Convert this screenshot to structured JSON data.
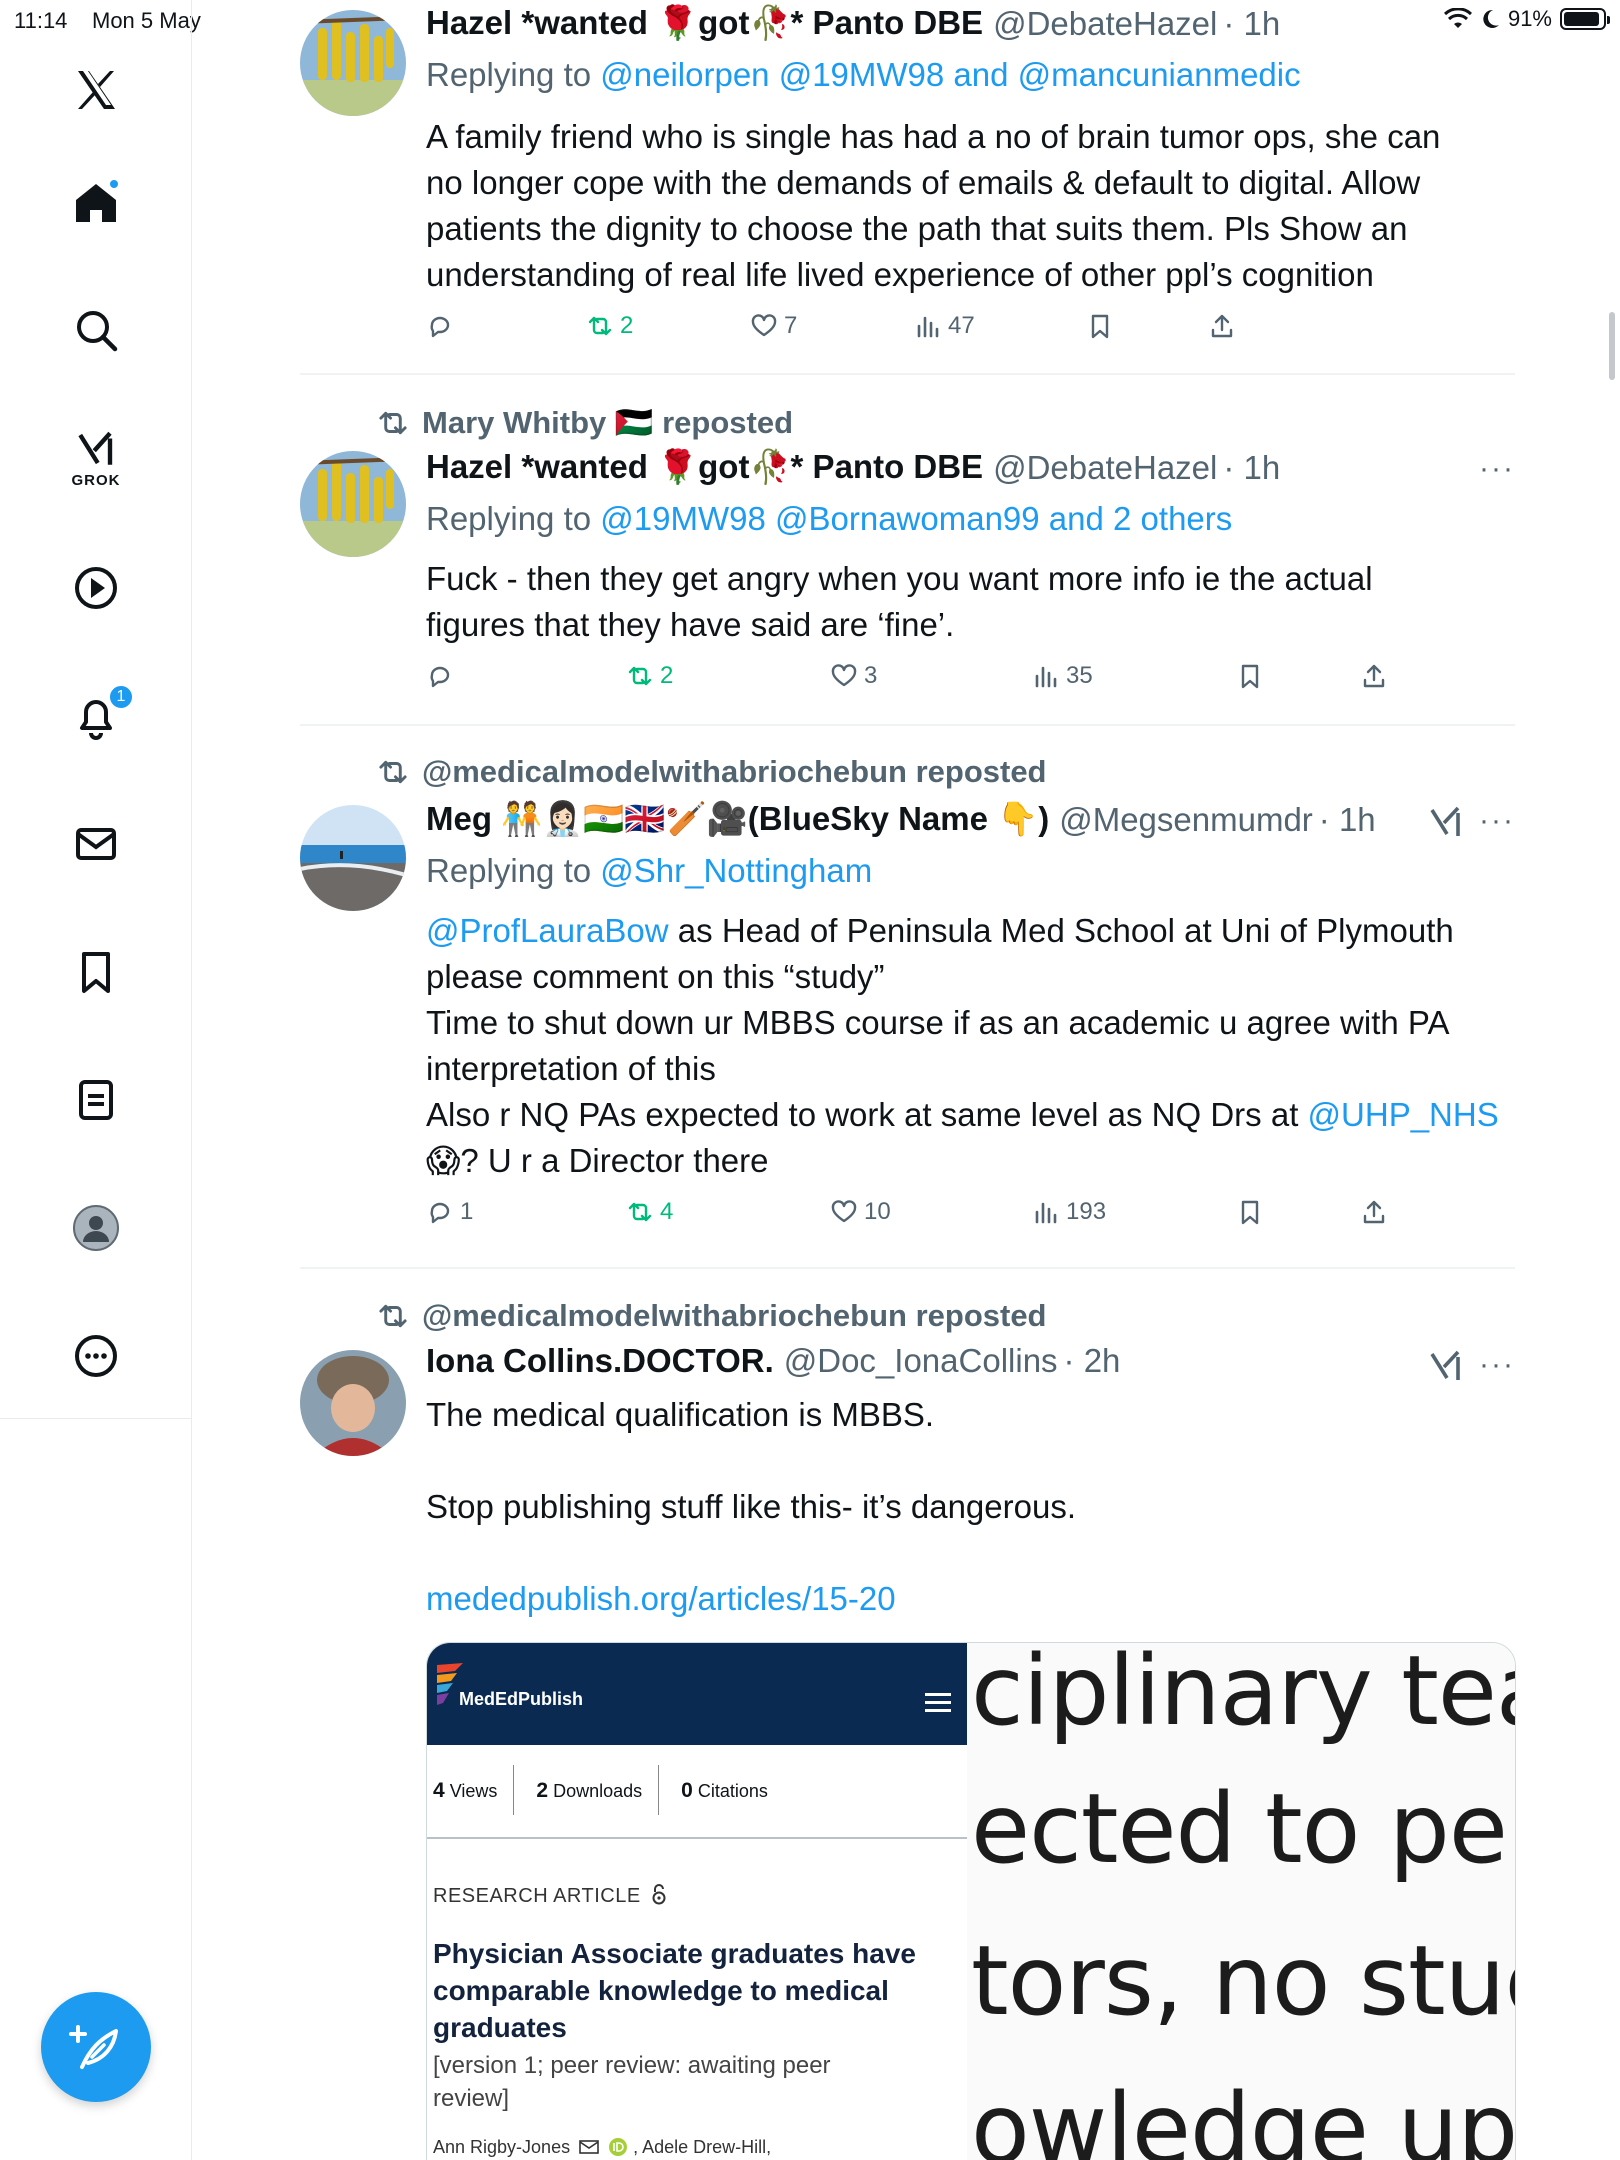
{
  "status_bar": {
    "time": "11:14",
    "date": "Mon 5 May",
    "battery": "91%",
    "battery_level": 0.91
  },
  "sidebar": {
    "items": [
      {
        "name": "X",
        "icon": "x-logo-icon"
      },
      {
        "name": "Home",
        "icon": "home-icon"
      },
      {
        "name": "Explore",
        "icon": "search-icon"
      },
      {
        "name": "Grok",
        "icon": "grok-icon",
        "label": "GROK"
      },
      {
        "name": "Video",
        "icon": "play-icon"
      },
      {
        "name": "Notifications",
        "icon": "bell-icon",
        "badge": "1"
      },
      {
        "name": "Messages",
        "icon": "mail-icon"
      },
      {
        "name": "Bookmarks",
        "icon": "bookmark-icon"
      },
      {
        "name": "Lists",
        "icon": "list-icon"
      },
      {
        "name": "Profile",
        "icon": "profile-icon"
      },
      {
        "name": "More",
        "icon": "more-circle-icon"
      }
    ],
    "compose_icon": "compose-icon"
  },
  "posts": [
    {
      "name": "Hazel *wanted 🌹got🥀* Panto DBE",
      "handle": "@DebateHazel",
      "time": "· 1h",
      "replying_to_prefix": "Replying to ",
      "replying_to": "@neilorpen @19MW98 and @mancunianmedic",
      "text": [
        "A family friend who is single has had a no of brain tumor ops,  she can",
        "no longer cope with the demands of emails & default to digital. Allow",
        "patients the dignity to choose the path that suits them. Pls Show an",
        "understanding of real life lived experience of other ppl’s cognition"
      ],
      "replies": "",
      "reposts": "2",
      "likes": "7",
      "views": "47"
    },
    {
      "reposted_by": "Mary Whitby 🇵🇸 reposted",
      "name": "Hazel *wanted 🌹got🥀* Panto DBE",
      "handle": "@DebateHazel",
      "time": "· 1h",
      "more": "···",
      "replying_to_prefix": "Replying to ",
      "replying_to": "@19MW98 @Bornawoman99 and 2 others",
      "text": [
        "Fuck - then they get angry when you want more info ie the actual",
        "figures that they have said are ‘fine’."
      ],
      "replies": "",
      "reposts": "2",
      "likes": "3",
      "views": "35"
    },
    {
      "reposted_by": "@medicalmodelwithabriochebun reposted",
      "name": "Meg 🧑‍🤝‍🧑👩🏻‍⚕️🇮🇳🇬🇧🏏🎥(BlueSky Name 👇)",
      "handle": "@Megsenmumdr",
      "time": "· 1h",
      "more": "···",
      "replying_to_prefix": "Replying to ",
      "replying_to": "@Shr_Nottingham",
      "text_mention_1": "@ProfLauraBow",
      "text_line_1_rest": " as Head of Peninsula Med School at Uni of Plymouth",
      "text_line_2": "please comment on this “study”",
      "text_line_3": "Time to shut down ur MBBS course if as an academic u agree with PA",
      "text_line_4": "interpretation of this",
      "text_line_5_start": "Also r NQ PAs expected to work at same level as NQ Drs at ",
      "text_mention_2": "@UHP_NHS",
      "text_line_6": "😱? U r a Director there",
      "replies": "1",
      "reposts": "4",
      "likes": "10",
      "views": "193"
    },
    {
      "reposted_by": "@medicalmodelwithabriochebun reposted",
      "name": "Iona Collins.DOCTOR.",
      "handle": "@Doc_IonaCollins",
      "time": "· 2h",
      "more": "···",
      "text_line_1": "The medical qualification is MBBS.",
      "text_line_2": "Stop publishing stuff like this- it’s dangerous.",
      "link": "mededpublish.org/articles/15-20",
      "card": {
        "brand": "MedEdPublish",
        "views_count": "4",
        "views_label": "Views",
        "downloads_count": "2",
        "downloads_label": "Downloads",
        "citations_count": "0",
        "citations_label": "Citations",
        "article_type": "RESEARCH ARTICLE",
        "title": "Physician Associate graduates have comparable knowledge to medical graduates",
        "version": "[version 1; peer review: awaiting peer review]",
        "authors": "Ann Rigby-Jones",
        "authors_2": ", Adele Drew-Hill,",
        "zoom_lines": [
          "ciplinary tea",
          "ected to perf",
          "tors, no stuc",
          "owledge up"
        ]
      }
    }
  ]
}
